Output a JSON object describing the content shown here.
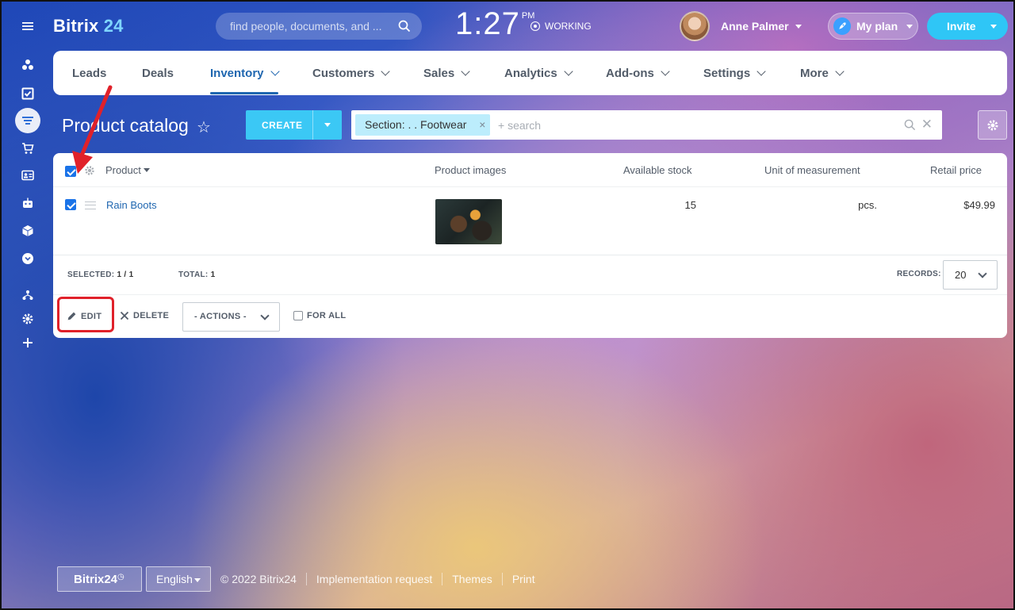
{
  "brand": {
    "name": "Bitrix",
    "num": "24"
  },
  "header": {
    "search_placeholder": "find people, documents, and ...",
    "clock": "1:27",
    "ampm": "PM",
    "work_status": "WORKING",
    "user_name": "Anne Palmer",
    "plan_label": "My plan",
    "invite_label": "Invite"
  },
  "nav": {
    "items": [
      {
        "label": "Leads"
      },
      {
        "label": "Deals"
      },
      {
        "label": "Inventory"
      },
      {
        "label": "Customers"
      },
      {
        "label": "Sales"
      },
      {
        "label": "Analytics"
      },
      {
        "label": "Add-ons"
      },
      {
        "label": "Settings"
      },
      {
        "label": "More"
      }
    ]
  },
  "page": {
    "title": "Product catalog",
    "create_label": "CREATE",
    "filter_chip": "Section: . . Footwear",
    "filter_add": "+ search"
  },
  "grid": {
    "columns": [
      "Product",
      "Product images",
      "Available stock",
      "Unit of measurement",
      "Retail price"
    ],
    "rows": [
      {
        "product": "Rain Boots",
        "stock": "15",
        "unit": "pcs.",
        "price": "$49.99"
      }
    ],
    "selected_label": "SELECTED:",
    "selected_value": "1 / 1",
    "total_label": "TOTAL:",
    "total_value": "1",
    "records_label": "RECORDS:",
    "records_value": "20"
  },
  "actions": {
    "edit": "EDIT",
    "delete": "DELETE",
    "actions_select": "- ACTIONS -",
    "for_all": "FOR ALL"
  },
  "footer": {
    "brand": "Bitrix24",
    "language": "English",
    "copyright": "© 2022 Bitrix24",
    "links": [
      "Implementation request",
      "Themes",
      "Print"
    ]
  },
  "colors": {
    "accent": "#2067b0",
    "create": "#3bc8f5",
    "invite": "#2fc6f6",
    "annotation": "#e0212a"
  }
}
